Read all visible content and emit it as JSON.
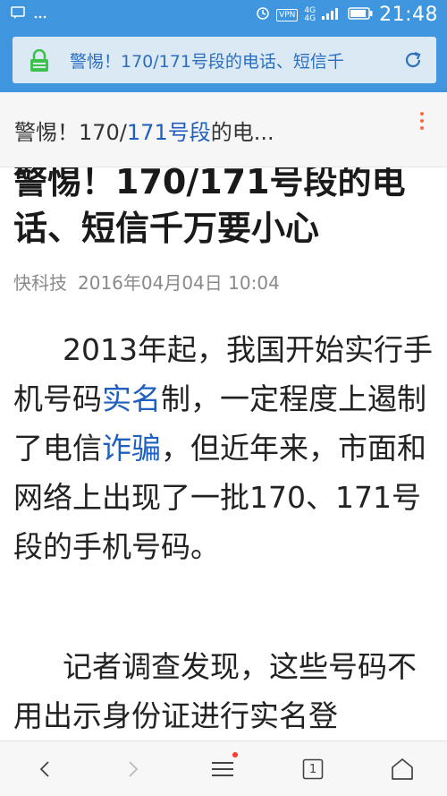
{
  "status_bar": {
    "time": "21:48",
    "vpn": "VPN",
    "network": "4G",
    "network2": "4G"
  },
  "url_bar": {
    "text": "警惕！170/171号段的电话、短信千"
  },
  "page_header": {
    "title_pre": "警惕！170/",
    "title_link": "171号段",
    "title_post": "的电..."
  },
  "article": {
    "title": "警惕！170/171号段的电话、短信千万要小心",
    "source": "快科技",
    "date": "2016年04月04日 10:04",
    "p1_a": "2013年起，我国开始实行手机号码",
    "p1_link1": "实名",
    "p1_b": "制，一定程度上遏制了电信",
    "p1_link2": "诈骗",
    "p1_c": "，但近年来，市面和网络上出现了一批170、171号段的手机号码。",
    "p2": "记者调查发现，这些号码不用出示身份证进行实名登"
  },
  "bottom_nav": {
    "tabs_count": "1"
  },
  "colors": {
    "brand": "#3f96df",
    "link": "#1f5fbf",
    "menu_dot": "#ff6a3d",
    "notify": "#ff3b30"
  }
}
